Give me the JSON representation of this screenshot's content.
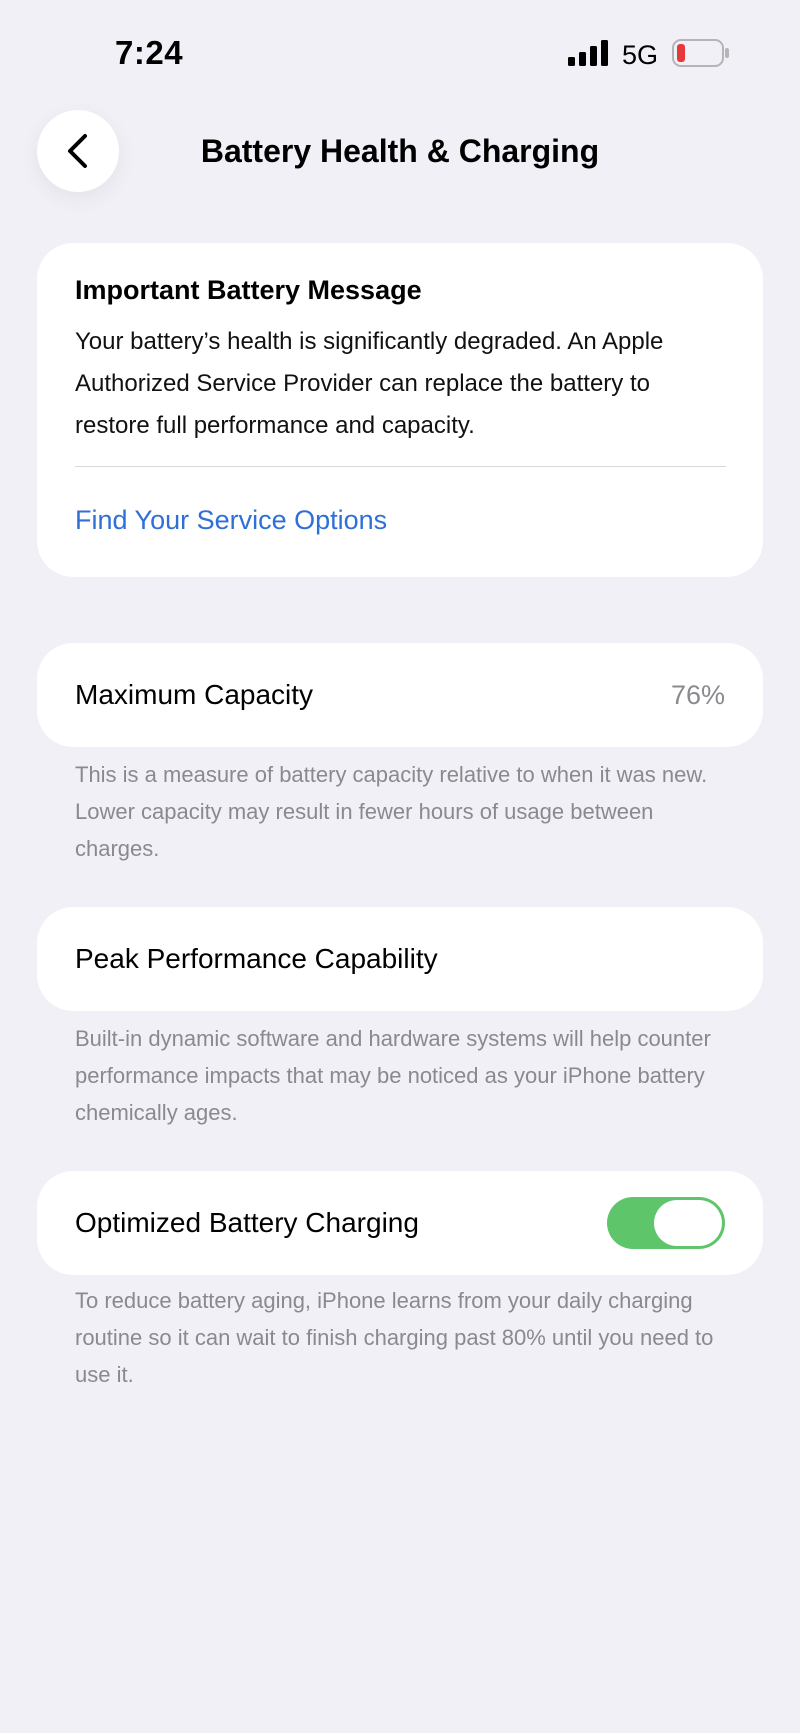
{
  "status_bar": {
    "time": "7:24",
    "network": "5G",
    "battery_color": "#e5393a"
  },
  "nav": {
    "title": "Battery Health & Charging"
  },
  "message": {
    "title": "Important Battery Message",
    "body": "Your battery’s health is significantly degraded. An Apple Authorized Service Provider can replace the battery to restore full performance and capacity.",
    "link": "Find Your Service Options",
    "link_color": "#2f6fd8"
  },
  "capacity": {
    "label": "Maximum Capacity",
    "value": "76%",
    "note": "This is a measure of battery capacity relative to when it was new. Lower capacity may result in fewer hours of usage between charges."
  },
  "peak": {
    "label": "Peak Performance Capability",
    "note": "Built-in dynamic software and hardware systems will help counter performance impacts that may be noticed as your iPhone battery chemically ages."
  },
  "optimized": {
    "label": "Optimized Battery Charging",
    "enabled": true,
    "toggle_color": "#5ec56a",
    "note": "To reduce battery aging, iPhone learns from your daily charging routine so it can wait to finish charging past 80% until you need to use it."
  }
}
